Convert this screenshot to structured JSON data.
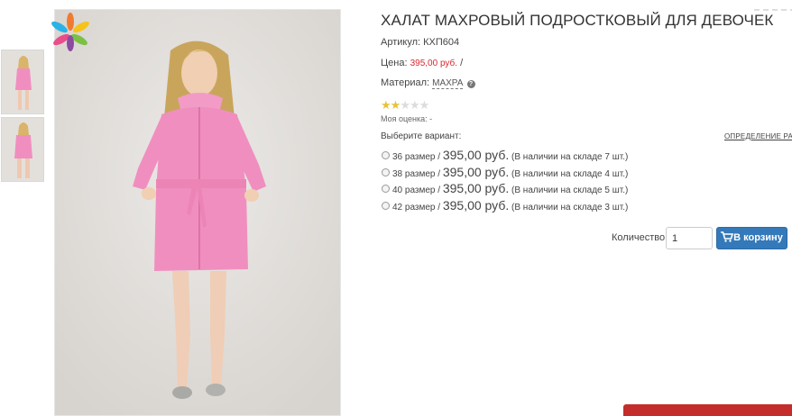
{
  "product": {
    "title": "ХАЛАТ МАХРОВЫЙ ПОДРОСТКОВЫЙ ДЛЯ ДЕВОЧЕК",
    "sku_label": "Артикул:",
    "sku_value": "КХП604",
    "price_label": "Цена:",
    "price_value": "395,00 руб.",
    "price_sep": "/",
    "material_label": "Материал:",
    "material_value": "МАХРА",
    "material_help": "?",
    "rating": {
      "value": 2,
      "max": 5,
      "my_rating_label": "Моя оценка: -"
    }
  },
  "variants": {
    "choose_label": "Выберите вариант:",
    "size_definition_link": "ОПРЕДЕЛЕНИЕ РАЗМ",
    "items": [
      {
        "size": "36 размер /",
        "price": "395,00 руб.",
        "stock": "(В наличии на складе 7 шт.)"
      },
      {
        "size": "38 размер /",
        "price": "395,00 руб.",
        "stock": "(В наличии на складе 4 шт.)"
      },
      {
        "size": "40 размер /",
        "price": "395,00 руб.",
        "stock": "(В наличии на складе 5 шт.)"
      },
      {
        "size": "42 размер /",
        "price": "395,00 руб.",
        "stock": "(В наличии на складе 3 шт.)"
      }
    ]
  },
  "purchase": {
    "quantity_label": "Количество",
    "quantity_value": "1",
    "add_to_cart_label": "В корзину"
  },
  "colors": {
    "price_red": "#d9272e",
    "button_blue": "#3479b9",
    "robe_pink": "#f08fbf",
    "bottom_bar_red": "#c32d2b",
    "star_gold": "#e8c23a"
  },
  "icons": [
    "logo-flower-icon",
    "help-circle-icon",
    "star-icon",
    "cart-icon"
  ]
}
